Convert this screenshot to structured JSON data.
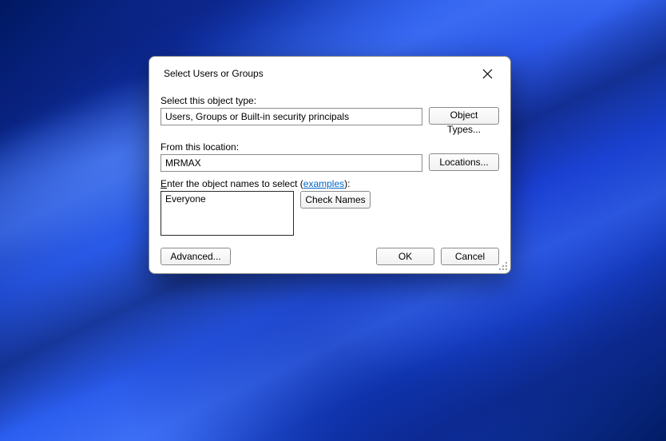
{
  "dialog": {
    "title": "Select Users or Groups",
    "objectType": {
      "label": "Select this object type:",
      "value": "Users, Groups or Built-in security principals",
      "button": "Object Types..."
    },
    "location": {
      "label": "From this location:",
      "value": "MRMAX",
      "button": "Locations..."
    },
    "names": {
      "labelPrefixUnd": "E",
      "labelRest": "nter the object names to select (",
      "examplesLink": "examples",
      "labelSuffix": "):",
      "value": "Everyone",
      "button": "Check Names"
    },
    "footer": {
      "advanced": "Advanced...",
      "ok": "OK",
      "cancel": "Cancel"
    }
  }
}
